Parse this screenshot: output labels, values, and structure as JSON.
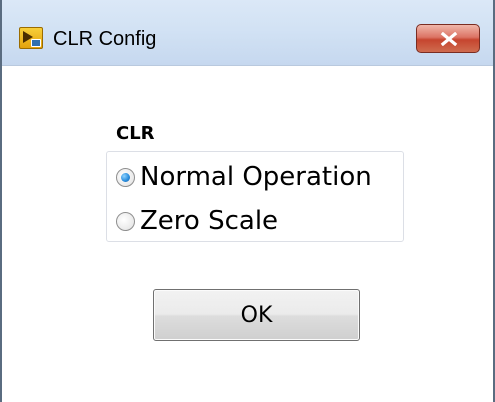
{
  "window": {
    "title": "CLR Config",
    "app_icon": "labview-vi-icon",
    "close_icon": "close-icon"
  },
  "group": {
    "label": "CLR",
    "options": [
      {
        "label": "Normal Operation",
        "selected": true
      },
      {
        "label": "Zero Scale",
        "selected": false
      }
    ]
  },
  "actions": {
    "ok_label": "OK"
  },
  "colors": {
    "titlebar": "#d2e2f4",
    "close_button": "#c6452f",
    "radio_selected": "#2d8fde"
  }
}
